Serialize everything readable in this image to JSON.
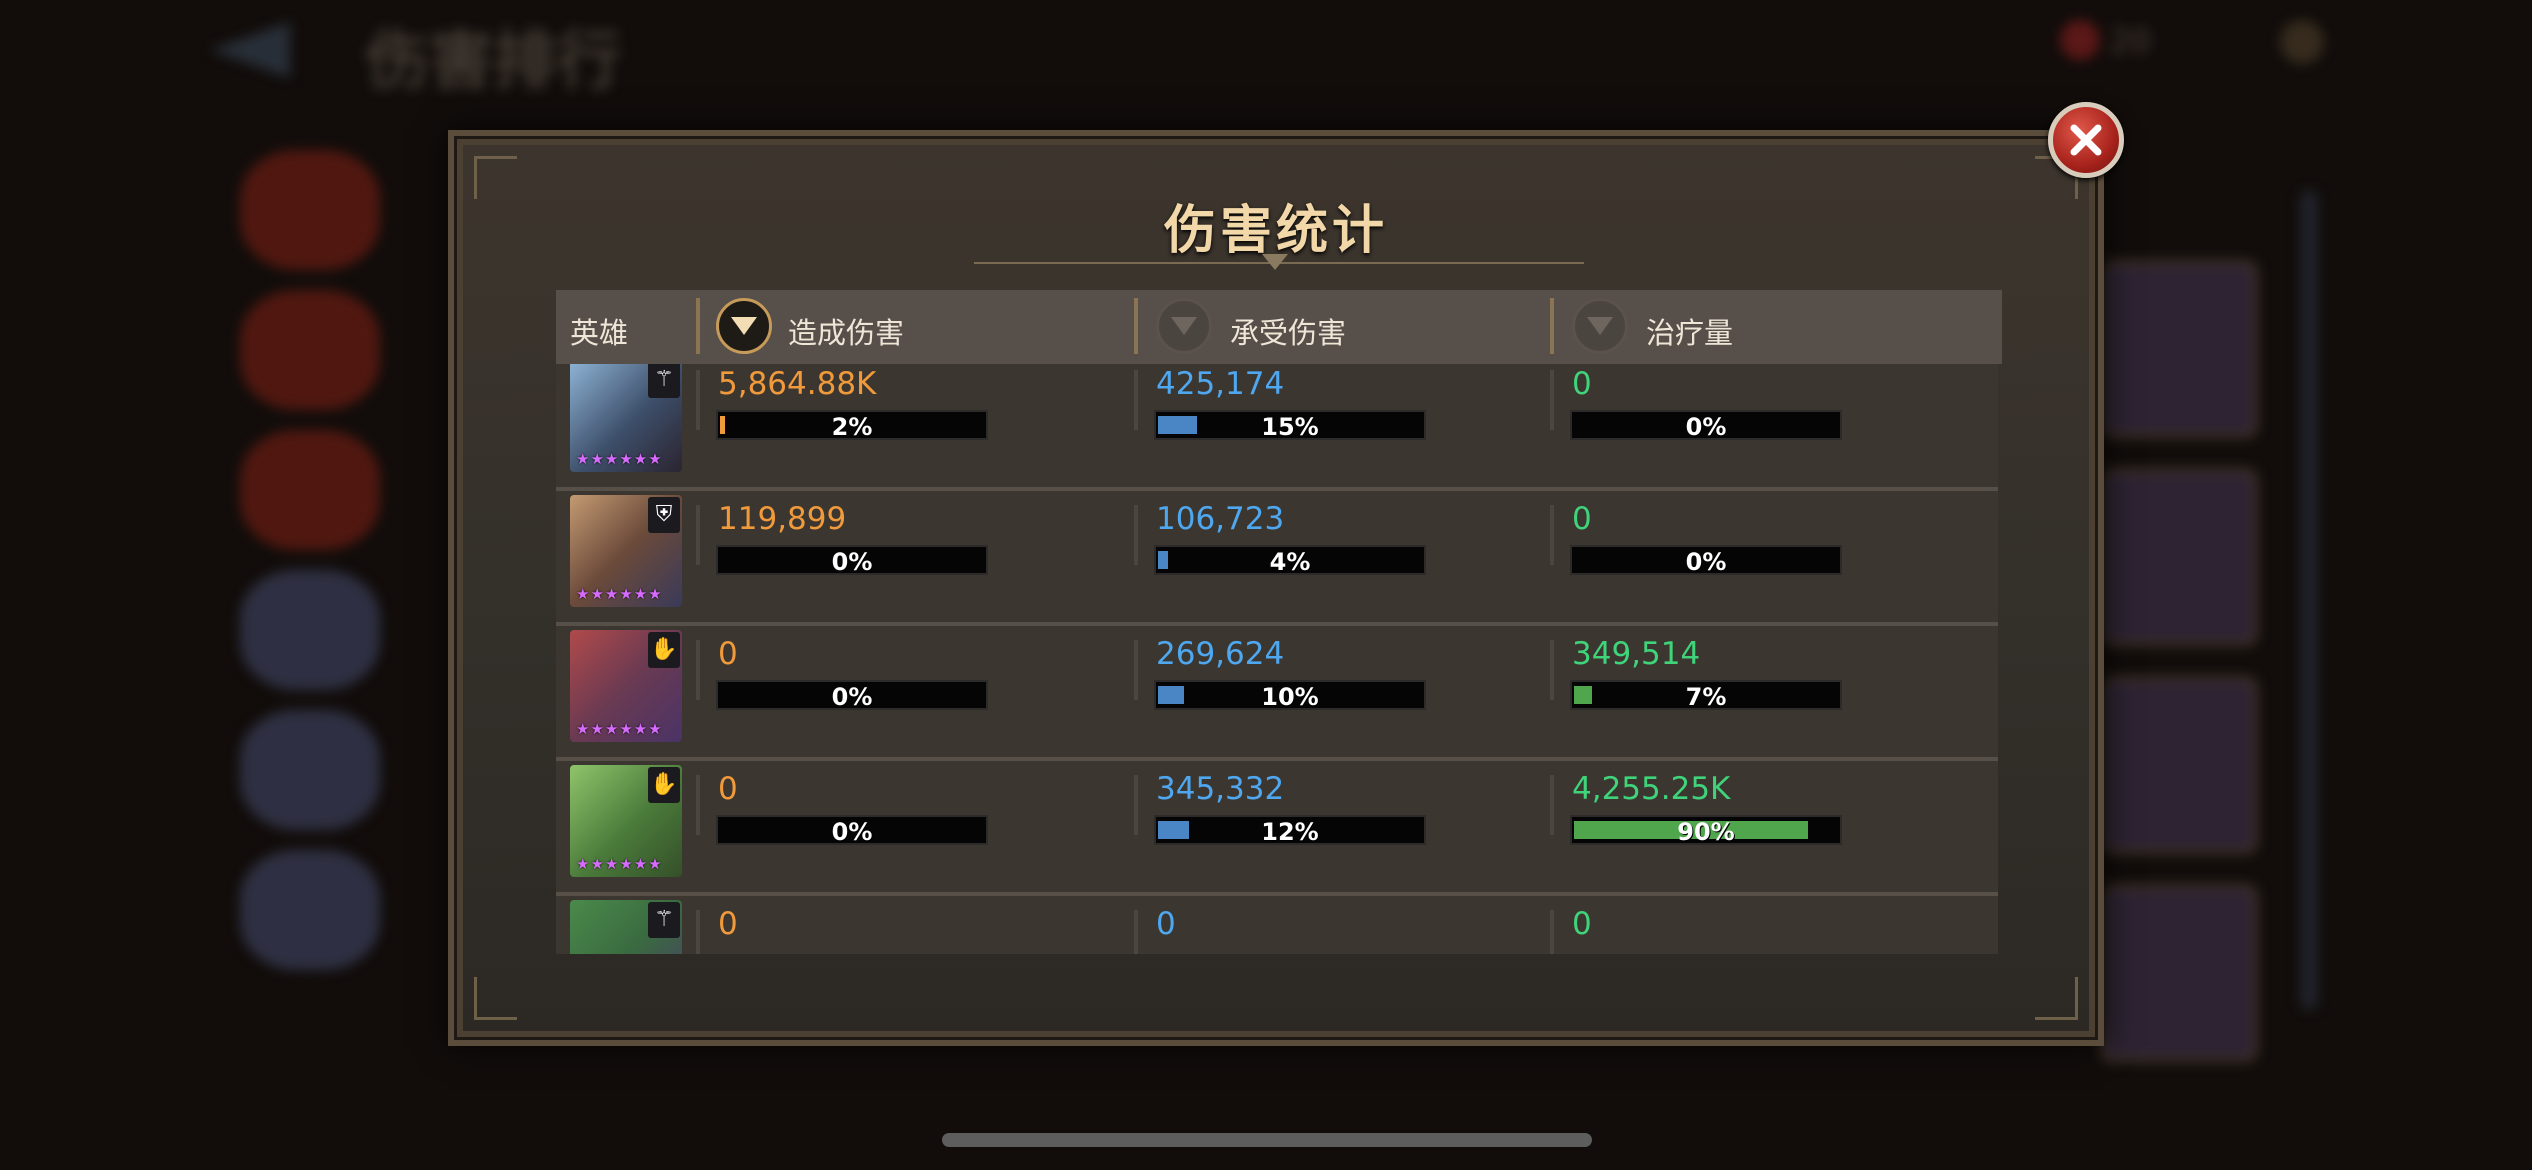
{
  "background": {
    "title": "伤害排行",
    "gem_value": "20"
  },
  "panel": {
    "title": "伤害统计"
  },
  "columns": {
    "hero": "英雄",
    "dealt": "造成伤害",
    "taken": "承受伤害",
    "heal": "治疗量"
  },
  "colors": {
    "dealt": "#f09a3c",
    "taken": "#4ea7ef",
    "heal": "#3fd37a",
    "taken_bar": "#4a86c6",
    "heal_bar": "#4fa64c",
    "star": "#d86bff"
  },
  "rows": [
    {
      "hero_icon": "hero-icon-1",
      "class_icon": "wand-icon",
      "stars": "★★★★★★",
      "dealt": {
        "value": "5,864.88K",
        "pct": "2%",
        "fill": 0.02
      },
      "taken": {
        "value": "425,174",
        "pct": "15%",
        "fill": 0.15
      },
      "heal": {
        "value": "0",
        "pct": "0%",
        "fill": 0
      }
    },
    {
      "hero_icon": "hero-icon-2",
      "class_icon": "shield-icon",
      "stars": "★★★★★★",
      "dealt": {
        "value": "119,899",
        "pct": "0%",
        "fill": 0
      },
      "taken": {
        "value": "106,723",
        "pct": "4%",
        "fill": 0.04
      },
      "heal": {
        "value": "0",
        "pct": "0%",
        "fill": 0
      }
    },
    {
      "hero_icon": "hero-icon-3",
      "class_icon": "praying-hands-icon",
      "stars": "★★★★★★",
      "dealt": {
        "value": "0",
        "pct": "0%",
        "fill": 0
      },
      "taken": {
        "value": "269,624",
        "pct": "10%",
        "fill": 0.1
      },
      "heal": {
        "value": "349,514",
        "pct": "7%",
        "fill": 0.07
      }
    },
    {
      "hero_icon": "hero-icon-4",
      "class_icon": "praying-hands-icon",
      "stars": "★★★★★★",
      "dealt": {
        "value": "0",
        "pct": "0%",
        "fill": 0
      },
      "taken": {
        "value": "345,332",
        "pct": "12%",
        "fill": 0.12
      },
      "heal": {
        "value": "4,255.25K",
        "pct": "90%",
        "fill": 0.9
      }
    },
    {
      "hero_icon": "hero-icon-5",
      "class_icon": "wand-icon",
      "stars": "★★★★★★",
      "dealt": {
        "value": "0",
        "pct": "",
        "fill": 0
      },
      "taken": {
        "value": "0",
        "pct": "",
        "fill": 0
      },
      "heal": {
        "value": "0",
        "pct": "",
        "fill": 0
      }
    }
  ]
}
